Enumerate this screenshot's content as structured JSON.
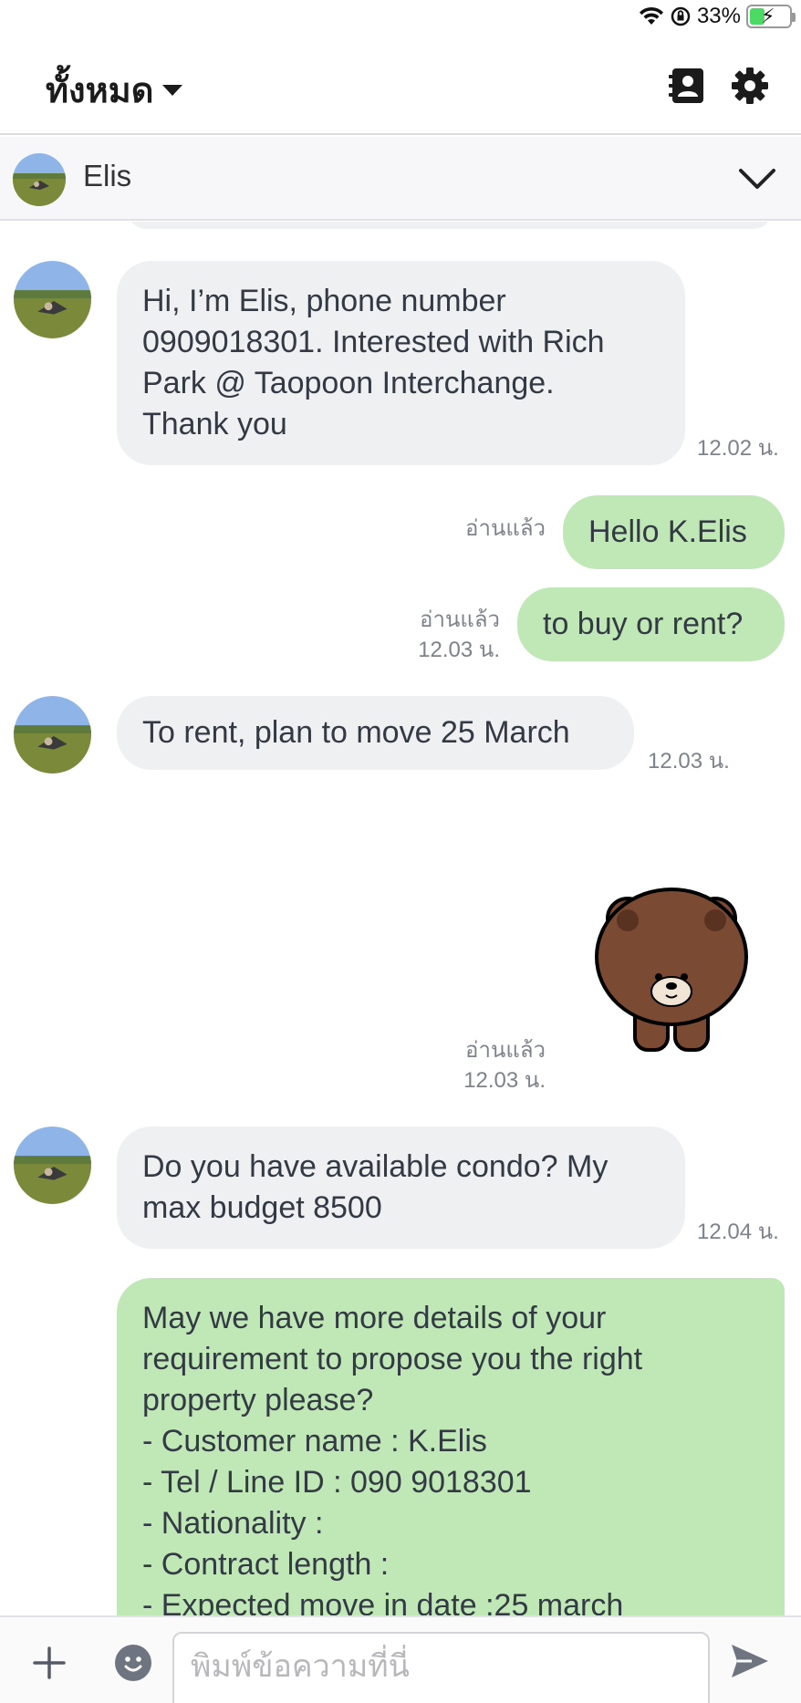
{
  "status_bar": {
    "battery": "33%",
    "wifi_icon": "wifi-icon",
    "lock_icon": "rotation-lock-icon",
    "battery_icon": "battery-charging-icon"
  },
  "header": {
    "title": "ทั้งหมด",
    "contacts_icon": "contacts-icon",
    "settings_icon": "gear-icon"
  },
  "chat": {
    "name": "Elis",
    "collapse_icon": "chevron-down-icon"
  },
  "messages": [
    {
      "id": "m1",
      "direction": "in",
      "lines": [
        "Hi, I’m Elis, phone number",
        "0909018301. Interested with Rich",
        "Park @ Taopoon Interchange.",
        "Thank you"
      ],
      "time": "12.02 น."
    },
    {
      "id": "m2",
      "direction": "out",
      "lines": [
        "Hello K.Elis"
      ],
      "read": "อ่านแล้ว",
      "time": ""
    },
    {
      "id": "m3",
      "direction": "out",
      "lines": [
        "to buy or rent?"
      ],
      "read": "อ่านแล้ว",
      "time": "12.03 น."
    },
    {
      "id": "m4",
      "direction": "in",
      "lines": [
        "To rent, plan to move 25 March"
      ],
      "time": "12.03 น."
    },
    {
      "id": "m5",
      "direction": "out",
      "type": "sticker",
      "sticker": "brown-bear-sticker",
      "read": "อ่านแล้ว",
      "time": "12.03 น."
    },
    {
      "id": "m6",
      "direction": "in",
      "lines": [
        "Do you have available condo? My",
        "max budget 8500"
      ],
      "time": "12.04 น."
    },
    {
      "id": "m7",
      "direction": "out",
      "lines": [
        "May we have more details of your",
        "requirement to propose you the right",
        "property please?",
        "- Customer name : K.Elis",
        "- Tel / Line ID : 090 9018301",
        "- Nationality :",
        "- Contract length :",
        "- Expected move in date :25 march"
      ]
    }
  ],
  "composer": {
    "placeholder": "พิมพ์ข้อความที่นี่",
    "plus_icon": "plus-icon",
    "emoji_icon": "emoji-icon",
    "send_icon": "send-icon"
  }
}
